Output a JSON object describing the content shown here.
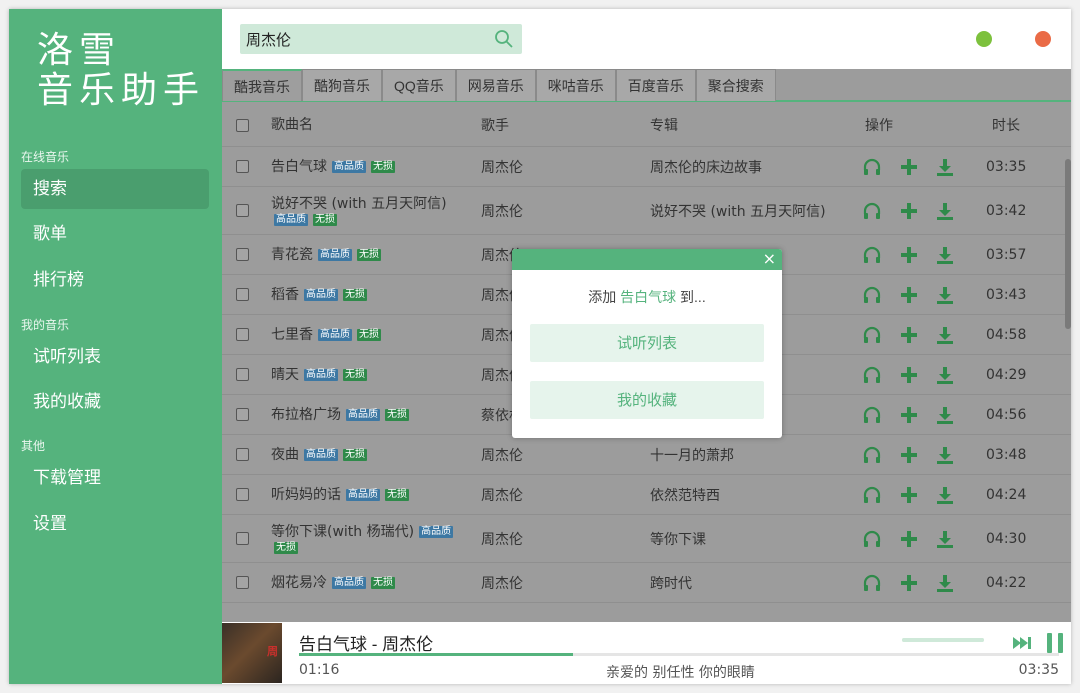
{
  "app": {
    "logo_line1": "洛雪",
    "logo_line2": "音乐助手"
  },
  "sidebar": {
    "sections": [
      {
        "title": "在线音乐",
        "items": [
          "搜索",
          "歌单",
          "排行榜"
        ]
      },
      {
        "title": "我的音乐",
        "items": [
          "试听列表",
          "我的收藏"
        ]
      },
      {
        "title": "其他",
        "items": [
          "下载管理",
          "设置"
        ]
      }
    ],
    "active": "搜索"
  },
  "search": {
    "value": "周杰伦",
    "icon": "search-icon"
  },
  "window": {
    "min_color": "#7dc13d",
    "close_color": "#ea6b46"
  },
  "tabs": [
    "酷我音乐",
    "酷狗音乐",
    "QQ音乐",
    "网易音乐",
    "咪咕音乐",
    "百度音乐",
    "聚合搜索"
  ],
  "active_tab": "酷我音乐",
  "table": {
    "headers": {
      "name": "歌曲名",
      "artist": "歌手",
      "album": "专辑",
      "ops": "操作",
      "duration": "时长"
    },
    "rows": [
      {
        "name": "告白气球",
        "hq": "高品质",
        "lossless": "无损",
        "artist": "周杰伦",
        "album": "周杰伦的床边故事",
        "duration": "03:35"
      },
      {
        "name": "说好不哭 (with 五月天阿信)",
        "hq": "高品质",
        "lossless": "无损",
        "artist": "周杰伦",
        "album": "说好不哭 (with 五月天阿信)",
        "duration": "03:42"
      },
      {
        "name": "青花瓷",
        "hq": "高品质",
        "lossless": "无损",
        "artist": "周杰伦",
        "album": "",
        "duration": "03:57"
      },
      {
        "name": "稻香",
        "hq": "高品质",
        "lossless": "无损",
        "artist": "周杰伦",
        "album": "",
        "duration": "03:43"
      },
      {
        "name": "七里香",
        "hq": "高品质",
        "lossless": "无损",
        "artist": "周杰伦",
        "album": "",
        "duration": "04:58"
      },
      {
        "name": "晴天",
        "hq": "高品质",
        "lossless": "无损",
        "artist": "周杰伦",
        "album": "",
        "duration": "04:29"
      },
      {
        "name": "布拉格广场",
        "hq": "高品质",
        "lossless": "无损",
        "artist": "蔡依林",
        "album": "",
        "duration": "04:56"
      },
      {
        "name": "夜曲",
        "hq": "高品质",
        "lossless": "无损",
        "artist": "周杰伦",
        "album": "十一月的萧邦",
        "duration": "03:48"
      },
      {
        "name": "听妈妈的话",
        "hq": "高品质",
        "lossless": "无损",
        "artist": "周杰伦",
        "album": "依然范特西",
        "duration": "04:24"
      },
      {
        "name": "等你下课(with 杨瑞代)",
        "hq": "高品质",
        "lossless": "无损",
        "artist": "周杰伦",
        "album": "等你下课",
        "duration": "04:30"
      },
      {
        "name": "烟花易冷",
        "hq": "高品质",
        "lossless": "无损",
        "artist": "周杰伦",
        "album": "跨时代",
        "duration": "04:22"
      }
    ]
  },
  "dialog": {
    "close": "×",
    "prefix": "添加",
    "song": "告白气球",
    "suffix": "到...",
    "option1": "试听列表",
    "option2": "我的收藏"
  },
  "player": {
    "title": "告白气球 - 周杰伦",
    "current": "01:16",
    "total": "03:35",
    "lyric": "亲爱的 别任性 你的眼睛",
    "progress": 0.36,
    "volume": 1.0
  },
  "colors": {
    "accent": "#55b37d",
    "hq_badge": "#3d78a3",
    "lossless_badge": "#2f8a4a"
  }
}
